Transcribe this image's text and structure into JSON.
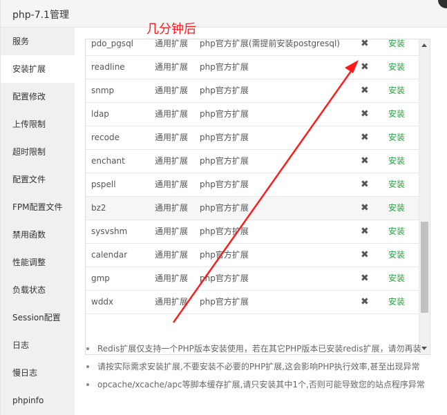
{
  "window": {
    "title": "php-7.1管理"
  },
  "sidebar": {
    "items": [
      {
        "label": "服务"
      },
      {
        "label": "安装扩展"
      },
      {
        "label": "配置修改"
      },
      {
        "label": "上传限制"
      },
      {
        "label": "超时限制"
      },
      {
        "label": "配置文件"
      },
      {
        "label": "FPM配置文件"
      },
      {
        "label": "禁用函数"
      },
      {
        "label": "性能调整"
      },
      {
        "label": "负载状态"
      },
      {
        "label": "Session配置"
      },
      {
        "label": "日志"
      },
      {
        "label": "慢日志"
      },
      {
        "label": "phpinfo"
      }
    ],
    "active_index": 1
  },
  "extensions": {
    "rows": [
      {
        "name": "pdo_pgsql",
        "type": "通用扩展",
        "desc": "php官方扩展(需提前安装postgresql)",
        "status": "✖",
        "action": "安装"
      },
      {
        "name": "readline",
        "type": "通用扩展",
        "desc": "php官方扩展",
        "status": "✖",
        "action": "安装"
      },
      {
        "name": "snmp",
        "type": "通用扩展",
        "desc": "php官方扩展",
        "status": "✖",
        "action": "安装"
      },
      {
        "name": "ldap",
        "type": "通用扩展",
        "desc": "php官方扩展",
        "status": "✖",
        "action": "安装"
      },
      {
        "name": "recode",
        "type": "通用扩展",
        "desc": "php官方扩展",
        "status": "✖",
        "action": "安装"
      },
      {
        "name": "enchant",
        "type": "通用扩展",
        "desc": "php官方扩展",
        "status": "✖",
        "action": "安装"
      },
      {
        "name": "pspell",
        "type": "通用扩展",
        "desc": "php官方扩展",
        "status": "✖",
        "action": "安装"
      },
      {
        "name": "bz2",
        "type": "通用扩展",
        "desc": "php官方扩展",
        "status": "✖",
        "action": "安装"
      },
      {
        "name": "sysvshm",
        "type": "通用扩展",
        "desc": "php官方扩展",
        "status": "✖",
        "action": "安装"
      },
      {
        "name": "calendar",
        "type": "通用扩展",
        "desc": "php官方扩展",
        "status": "✖",
        "action": "安装"
      },
      {
        "name": "gmp",
        "type": "通用扩展",
        "desc": "php官方扩展",
        "status": "✖",
        "action": "安装"
      },
      {
        "name": "wddx",
        "type": "通用扩展",
        "desc": "php官方扩展",
        "status": "✖",
        "action": "安装"
      }
    ],
    "highlighted_index": 7
  },
  "notes": [
    "Redis扩展仅支持一个PHP版本安装使用，若在其它PHP版本已安装redis扩展，请勿再装",
    "请按实际需求安装扩展,不要安装不必要的PHP扩展,这会影响PHP执行效率,甚至出现异常",
    "opcache/xcache/apc等脚本缓存扩展,请只安装其中1个,否则可能导致您的站点程序异常"
  ],
  "annotation": {
    "text": "几分钟后",
    "color": "#ff1a1a"
  },
  "colors": {
    "action_green": "#20a53a",
    "sidebar_bg": "#f0f0f0"
  },
  "icons": {
    "status": "cross-icon",
    "close": "close-icon"
  }
}
